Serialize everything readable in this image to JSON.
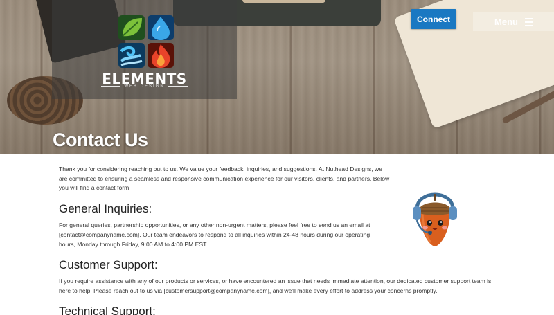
{
  "brand": {
    "name": "ELEMENTS",
    "tagline": "WEB DESIGN"
  },
  "header": {
    "connect_label": "Connect",
    "menu_label": "Menu"
  },
  "page": {
    "title": "Contact Us",
    "intro": "Thank you for considering reaching out to us. We value your feedback, inquiries, and suggestions. At Nuthead Designs, we are committed to ensuring a seamless and responsive communication experience for our visitors, clients, and partners. Below you will find a contact form"
  },
  "sections": [
    {
      "heading": "General Inquiries:",
      "text": "For general queries, partnership opportunities, or any other non-urgent matters, please feel free to send us an email at [contact@companyname.com]. Our team endeavors to respond to all inquiries within 24-48 hours during our operating hours, Monday through Friday, 9:00 AM to 4:00 PM EST."
    },
    {
      "heading": "Customer Support:",
      "text": "If you require assistance with any of our products or services, or have encountered an issue that needs immediate attention, our dedicated customer support team is here to help. Please reach out to us via [customersupport@companyname.com], and we'll make every effort to address your concerns promptly."
    },
    {
      "heading": "Technical Support:"
    }
  ],
  "colors": {
    "accent": "#1a78c2",
    "text": "#333333",
    "heading": "#222222"
  },
  "icons": {
    "logo": "elements-logo-icon",
    "menu": "hamburger-icon",
    "mascot": "acorn-headset-mascot"
  }
}
